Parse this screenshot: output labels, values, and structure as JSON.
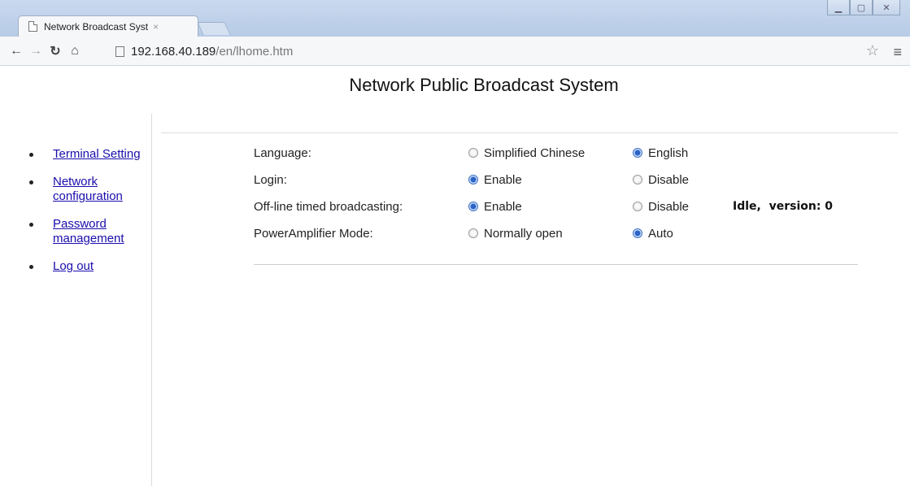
{
  "browser": {
    "tab_title": "Network Broadcast Syst",
    "tab_close": "×",
    "url_host": "192.168.40.189",
    "url_path": "/en/lhome.htm"
  },
  "page": {
    "title": "Network Public Broadcast System"
  },
  "sidebar": {
    "items": [
      {
        "label": "Terminal Setting"
      },
      {
        "label": "Network configuration"
      },
      {
        "label": "Password management"
      },
      {
        "label": "Log out"
      }
    ]
  },
  "settings": {
    "rows": [
      {
        "label": "Language:",
        "option_a": "Simplified Chinese",
        "option_b": "English",
        "selected": "b"
      },
      {
        "label": "Login:",
        "option_a": "Enable",
        "option_b": "Disable",
        "selected": "a"
      },
      {
        "label": "Off-line timed broadcasting:",
        "option_a": "Enable",
        "option_b": "Disable",
        "selected": "a",
        "status": "Idle,  version: 0"
      },
      {
        "label": "PowerAmplifier Mode:",
        "option_a": "Normally open",
        "option_b": "Auto",
        "selected": "b"
      }
    ]
  },
  "colors": {
    "link": "#1a0dab",
    "radio_selected": "#2a63c7"
  }
}
